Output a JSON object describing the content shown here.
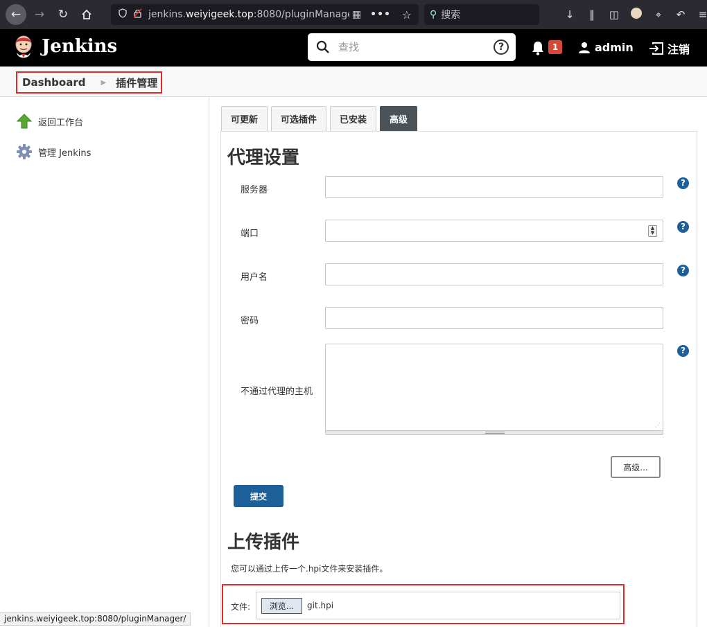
{
  "browser": {
    "url_prefix": "jenkins.",
    "url_host": "weiyigeek.top",
    "url_suffix": ":8080/pluginManager/",
    "more_label": "•••",
    "search_placeholder": "搜索"
  },
  "header": {
    "brand": "Jenkins",
    "search_placeholder": "查找",
    "notification_count": "1",
    "username": "admin",
    "logout_label": "注销"
  },
  "breadcrumb": {
    "items": [
      "Dashboard",
      "插件管理"
    ]
  },
  "sidebar": {
    "items": [
      {
        "label": "返回工作台",
        "icon": "up-arrow-icon"
      },
      {
        "label": "管理 Jenkins",
        "icon": "gear-icon"
      }
    ]
  },
  "tabs": [
    {
      "label": "可更新",
      "active": false
    },
    {
      "label": "可选插件",
      "active": false
    },
    {
      "label": "已安装",
      "active": false
    },
    {
      "label": "高级",
      "active": true
    }
  ],
  "proxy": {
    "title": "代理设置",
    "fields": {
      "server": {
        "label": "服务器",
        "value": ""
      },
      "port": {
        "label": "端口",
        "value": ""
      },
      "username": {
        "label": "用户名",
        "value": ""
      },
      "password": {
        "label": "密码",
        "value": ""
      },
      "no_proxy_hosts": {
        "label": "不通过代理的主机",
        "value": ""
      }
    },
    "advanced_button": "高级...",
    "submit_button": "提交"
  },
  "upload": {
    "title": "上传插件",
    "description": "您可以通过上传一个.hpi文件来安装插件。",
    "file_label": "文件:",
    "browse_button": "浏览...",
    "file_name": "git.hpi"
  },
  "status_bar": {
    "text": "jenkins.weiyigeek.top:8080/pluginManager/"
  },
  "colors": {
    "header_bg": "#000000",
    "primary_button": "#1d5f99",
    "highlight_border": "#e02b2b",
    "active_tab": "#4b5258",
    "notification_badge": "#d24939"
  }
}
